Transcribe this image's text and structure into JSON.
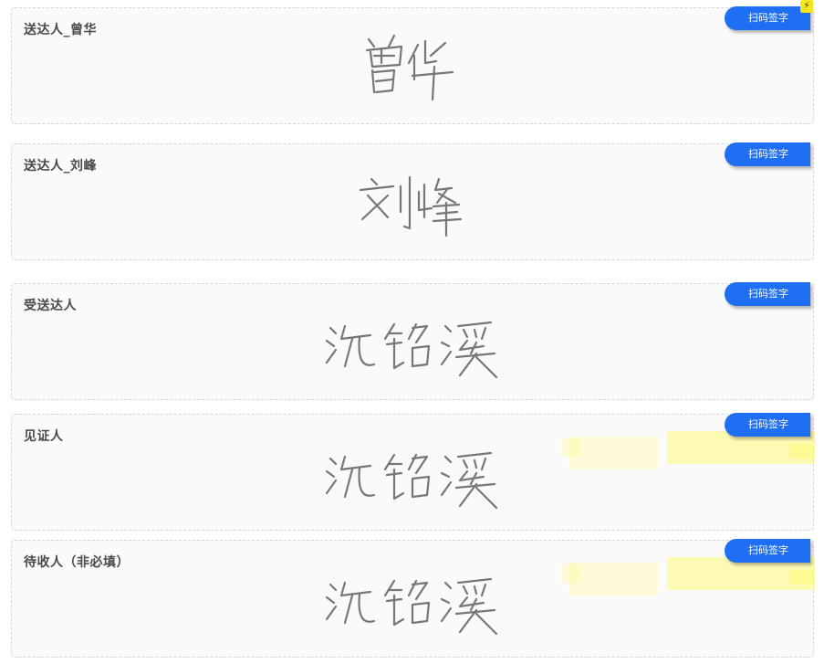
{
  "cards": [
    {
      "label": "送达人_曾华",
      "button": "扫码签字",
      "signature": "曾华"
    },
    {
      "label": "送达人_刘峰",
      "button": "扫码签字",
      "signature": "刘峰"
    },
    {
      "label": "受送达人",
      "button": "扫码签字",
      "signature": "沈铭溪"
    },
    {
      "label": "见证人",
      "button": "扫码签字",
      "signature": "沈铭溪"
    },
    {
      "label": "待收人（非必填）",
      "button": "扫码签字",
      "signature": "沈铭溪"
    }
  ],
  "icons": {
    "badge": "lightning-bolt-icon"
  },
  "colors": {
    "button": "#1f6ff5",
    "highlight": "#fff87a",
    "badge": "#f5e51a"
  }
}
